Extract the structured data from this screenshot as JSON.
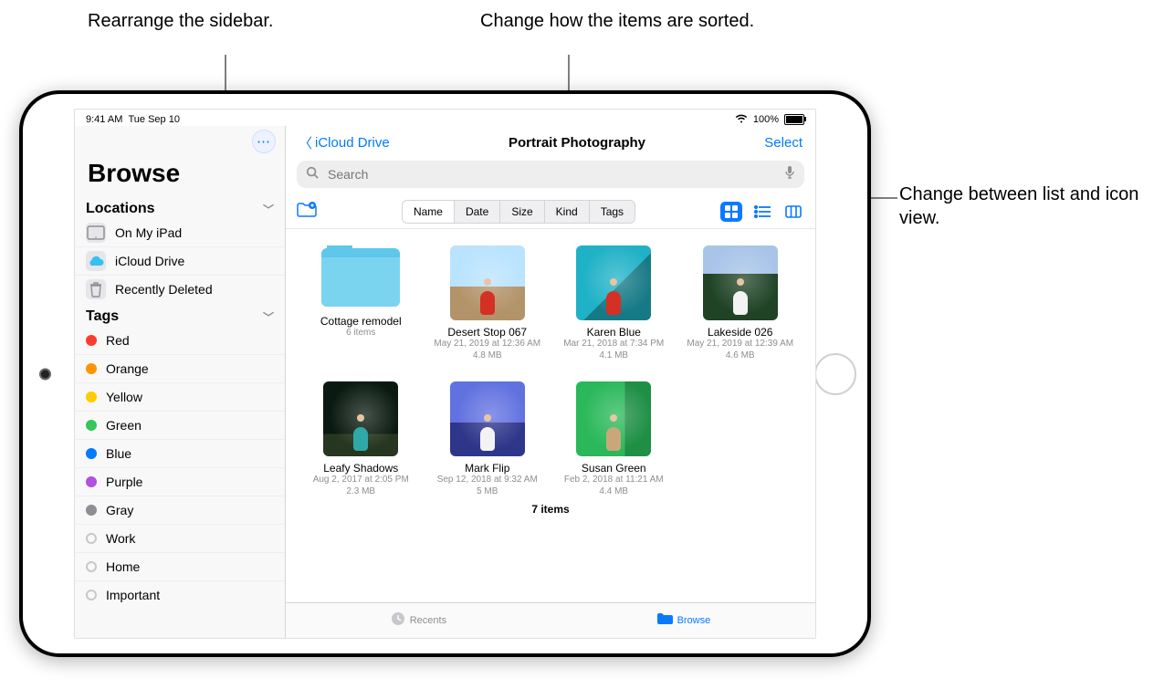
{
  "annotations": {
    "sidebar": "Rearrange the sidebar.",
    "sort": "Change how the items are sorted.",
    "view": "Change between list and icon view."
  },
  "status": {
    "time": "9:41 AM",
    "date": "Tue Sep 10",
    "battery_pct": "100%"
  },
  "sidebar": {
    "more_btn_glyph": "⋯",
    "title": "Browse",
    "sections": {
      "locations_label": "Locations",
      "tags_label": "Tags"
    },
    "locations": [
      {
        "label": "On My iPad",
        "icon": "ipad"
      },
      {
        "label": "iCloud Drive",
        "icon": "cloud"
      },
      {
        "label": "Recently Deleted",
        "icon": "trash"
      }
    ],
    "tags": [
      {
        "label": "Red",
        "color": "#ff3b30"
      },
      {
        "label": "Orange",
        "color": "#ff9500"
      },
      {
        "label": "Yellow",
        "color": "#ffcc00"
      },
      {
        "label": "Green",
        "color": "#34c759"
      },
      {
        "label": "Blue",
        "color": "#007aff"
      },
      {
        "label": "Purple",
        "color": "#af52de"
      },
      {
        "label": "Gray",
        "color": "#8e8e93"
      },
      {
        "label": "Work",
        "color": ""
      },
      {
        "label": "Home",
        "color": ""
      },
      {
        "label": "Important",
        "color": ""
      }
    ]
  },
  "nav": {
    "back_label": "iCloud Drive",
    "title": "Portrait Photography",
    "select_label": "Select"
  },
  "search": {
    "placeholder": "Search"
  },
  "sort": {
    "options": [
      "Name",
      "Date",
      "Size",
      "Kind",
      "Tags"
    ],
    "active_index": 0
  },
  "view": {
    "active": "icon"
  },
  "items": [
    {
      "name": "Cottage remodel",
      "meta1": "6 items",
      "meta2": "",
      "kind": "folder"
    },
    {
      "name": "Desert Stop 067",
      "meta1": "May 21, 2019 at 12:36 AM",
      "meta2": "4.8 MB",
      "kind": "image",
      "ph": "ph1",
      "fig": "red"
    },
    {
      "name": "Karen Blue",
      "meta1": "Mar 21, 2018 at 7:34 PM",
      "meta2": "4.1 MB",
      "kind": "image",
      "ph": "ph2",
      "fig": "red"
    },
    {
      "name": "Lakeside 026",
      "meta1": "May 21, 2019 at 12:39 AM",
      "meta2": "4.6 MB",
      "kind": "image",
      "ph": "ph3",
      "fig": "white"
    },
    {
      "name": "Leafy Shadows",
      "meta1": "Aug 2, 2017 at 2:05 PM",
      "meta2": "2.3 MB",
      "kind": "image",
      "ph": "ph4",
      "fig": "teal"
    },
    {
      "name": "Mark Flip",
      "meta1": "Sep 12, 2018 at 9:32 AM",
      "meta2": "5 MB",
      "kind": "image",
      "ph": "ph5",
      "fig": "white"
    },
    {
      "name": "Susan Green",
      "meta1": "Feb 2, 2018 at 11:21 AM",
      "meta2": "4.4 MB",
      "kind": "image",
      "ph": "ph6",
      "fig": "tan"
    }
  ],
  "footer_count": "7 items",
  "tabs": {
    "recents": "Recents",
    "browse": "Browse"
  }
}
